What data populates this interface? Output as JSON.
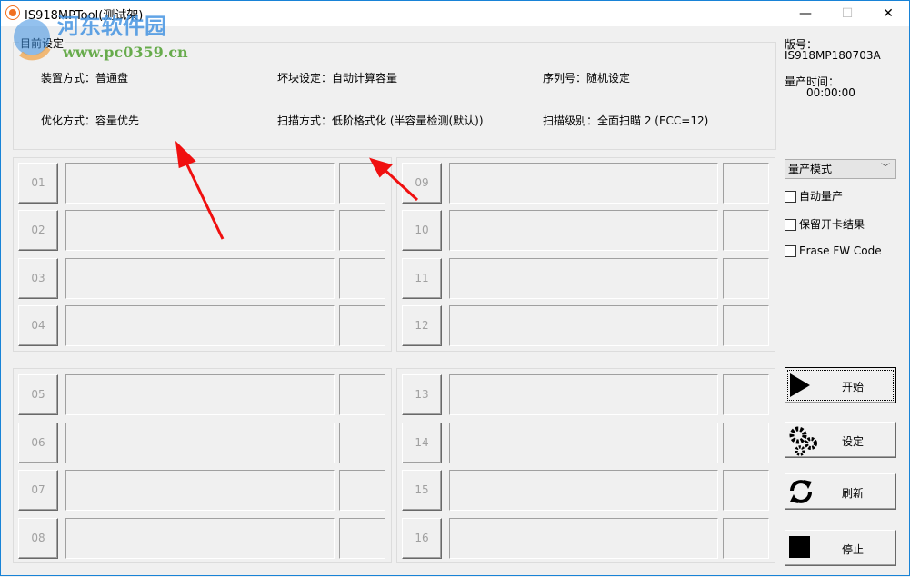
{
  "window": {
    "title": "IS918MPTool(测试架)",
    "minimize": "—",
    "maximize": "☐",
    "close": "✕"
  },
  "watermark": {
    "name": "河东软件园",
    "url": "www.pc0359.cn"
  },
  "settings": {
    "group_label": "目前设定",
    "device_mode": "装置方式：普通盘",
    "bad_block": "坏块设定：自动计算容量",
    "serial": "序列号：随机设定",
    "optimize": "优化方式：容量优先",
    "scan_mode": "扫描方式：低阶格式化 (半容量检测(默认))",
    "scan_level": "扫描级别：全面扫瞄 2 (ECC=12)"
  },
  "slots": [
    "01",
    "02",
    "03",
    "04",
    "05",
    "06",
    "07",
    "08",
    "09",
    "10",
    "11",
    "12",
    "13",
    "14",
    "15",
    "16"
  ],
  "side": {
    "version_label": "版号：",
    "version": "IS918MP180703A",
    "time_label": "量产时间：",
    "time": "00:00:00",
    "mode_select": "量产模式",
    "checkboxes": [
      {
        "label": "自动量产",
        "checked": false
      },
      {
        "label": "保留开卡结果",
        "checked": false
      },
      {
        "label": "Erase FW Code",
        "checked": false
      }
    ],
    "buttons": {
      "start": "开始",
      "settings": "设定",
      "refresh": "刷新",
      "stop": "停止"
    }
  }
}
